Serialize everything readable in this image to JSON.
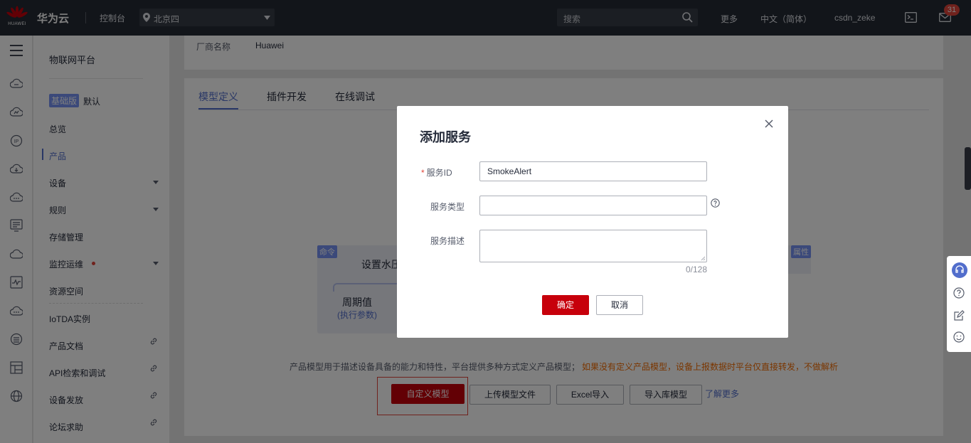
{
  "topbar": {
    "logo_text": "HUAWEI",
    "brand": "华为云",
    "console": "控制台",
    "region": "北京四",
    "search_placeholder": "搜索",
    "more": "更多",
    "language": "中文（简体）",
    "username": "csdn_zeke",
    "notification_count": "31"
  },
  "sidebar": {
    "title": "物联网平台",
    "edition_badge": "基础版",
    "edition_default": "默认",
    "items": [
      {
        "label": "总览"
      },
      {
        "label": "产品",
        "active": true
      },
      {
        "label": "设备",
        "expandable": true
      },
      {
        "label": "规则",
        "expandable": true
      },
      {
        "label": "存储管理"
      },
      {
        "label": "监控运维",
        "expandable": true,
        "dot": true
      },
      {
        "label": "资源空间"
      },
      {
        "label": "IoTDA实例"
      },
      {
        "label": "产品文档",
        "external": true
      },
      {
        "label": "API检索和调试",
        "external": true
      },
      {
        "label": "设备发放",
        "external": true
      },
      {
        "label": "论坛求助",
        "external": true
      }
    ]
  },
  "product_info": {
    "vendor_label": "厂商名称",
    "vendor_value": "Huawei"
  },
  "tabs": [
    {
      "label": "模型定义",
      "active": true
    },
    {
      "label": "插件开发"
    },
    {
      "label": "在线调试"
    }
  ],
  "illustration": {
    "tag_command": "命令",
    "title": "设置水压",
    "param_name": "周期值",
    "param_hint": "(执行参数)",
    "tag_property": "属性"
  },
  "model_intro": {
    "description": "产品模型用于描述设备具备的能力和特性，平台提供多种方式定义产品模型；",
    "warning": "如果没有定义产品模型，设备上报数据时平台仅直接转发，不做解析",
    "buttons": {
      "custom": "自定义模型",
      "upload": "上传模型文件",
      "excel": "Excel导入",
      "library": "导入库模型"
    },
    "learn_more": "了解更多"
  },
  "dialog": {
    "title": "添加服务",
    "fields": {
      "service_id_label": "服务ID",
      "service_id_value": "SmokeAlert",
      "service_type_label": "服务类型",
      "service_type_value": "",
      "service_desc_label": "服务描述",
      "service_desc_value": "",
      "desc_counter": "0/128"
    },
    "confirm": "确定",
    "cancel": "取消"
  },
  "colors": {
    "topbar_bg": "#252a35",
    "primary_red": "#c7000b",
    "accent_blue": "#526ecc",
    "warning_orange": "#f56c00"
  }
}
